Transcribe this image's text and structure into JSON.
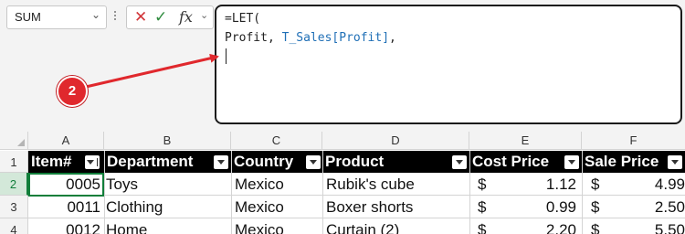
{
  "name_box": {
    "value": "SUM"
  },
  "formula_bar": {
    "cancel_glyph": "✕",
    "enter_glyph": "✓",
    "fx_label": "fx",
    "line1": "=LET(",
    "line2_name": "Profit, ",
    "line2_ref": "T_Sales[Profit]",
    "line2_comma": ","
  },
  "callout": {
    "badge": "2",
    "color": "#e0282d"
  },
  "columns": [
    "A",
    "B",
    "C",
    "D",
    "E",
    "F"
  ],
  "rows": [
    "1",
    "2",
    "3",
    "4"
  ],
  "table": {
    "headers": [
      "Item#",
      "Department",
      "Country",
      "Product",
      "Cost Price",
      "Sale Price"
    ],
    "rows": [
      {
        "item": "0005",
        "department": "Toys",
        "country": "Mexico",
        "product": "Rubik's cube",
        "cost_sym": "$",
        "cost": "1.12",
        "sale_sym": "$",
        "sale": "4.99"
      },
      {
        "item": "0011",
        "department": "Clothing",
        "country": "Mexico",
        "product": "Boxer shorts",
        "cost_sym": "$",
        "cost": "0.99",
        "sale_sym": "$",
        "sale": "2.50"
      },
      {
        "item": "0012",
        "department": "Home",
        "country": "Mexico",
        "product": "Curtain (2)",
        "cost_sym": "$",
        "cost": "2.20",
        "sale_sym": "$",
        "sale": "5.50"
      }
    ]
  },
  "colors": {
    "accent": "#117e3a",
    "header_bg": "#000000",
    "formula_ref": "#1f6fb6"
  }
}
